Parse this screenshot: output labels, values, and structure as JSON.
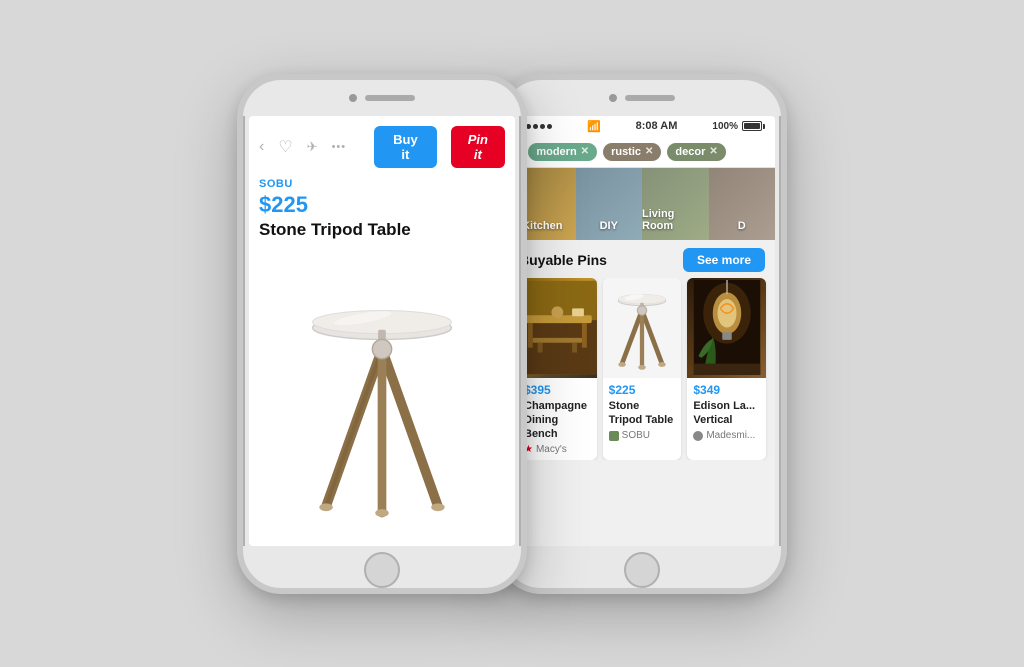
{
  "background": "#d8d8d8",
  "phones": {
    "left": {
      "status": "",
      "toolbar": {
        "back_icon": "‹",
        "heart_icon": "♡",
        "share_icon": "▷",
        "more_icon": "···",
        "buy_button": "Buy it",
        "pin_button": "Pin it"
      },
      "product": {
        "brand": "SOBU",
        "price": "$225",
        "name": "Stone Tripod Table"
      }
    },
    "right": {
      "status_bar": {
        "dots": 5,
        "wifi": "wifi",
        "time": "8:08 AM",
        "battery_pct": "100%"
      },
      "search": {
        "back_icon": "‹",
        "tags": [
          {
            "label": "modern",
            "color": "modern"
          },
          {
            "label": "rustic",
            "color": "rustic"
          },
          {
            "label": "decor",
            "color": "decor"
          }
        ]
      },
      "categories": [
        {
          "label": "Kitchen"
        },
        {
          "label": "DIY"
        },
        {
          "label": "Living Room"
        },
        {
          "label": "D..."
        }
      ],
      "buyable_pins": {
        "section_title": "Buyable Pins",
        "see_more": "See more",
        "pins": [
          {
            "price": "$395",
            "name": "Champagne Dining Bench",
            "store": "Macy's",
            "store_type": "macy"
          },
          {
            "price": "$225",
            "name": "Stone Tripod Table",
            "store": "SOBU",
            "store_type": "sobu"
          },
          {
            "price": "$349",
            "name": "Edison La... Vertical",
            "store": "Madesmi...",
            "store_type": "made"
          }
        ]
      }
    }
  }
}
